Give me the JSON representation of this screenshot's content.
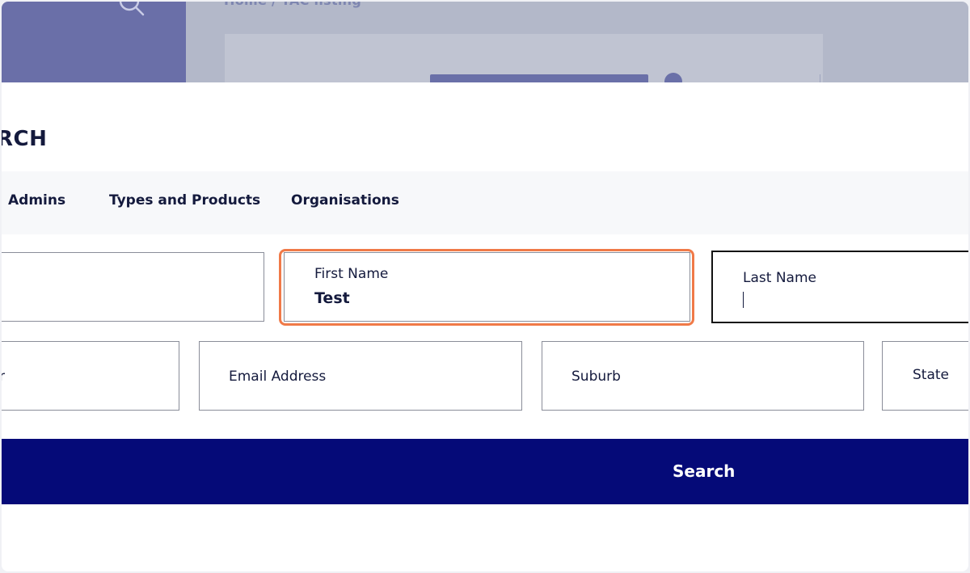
{
  "background": {
    "breadcrumb": "Home / TAC listing"
  },
  "panel": {
    "title": "RCH"
  },
  "tabs": [
    {
      "label": "Admins"
    },
    {
      "label": "Types and Products"
    },
    {
      "label": "Organisations"
    }
  ],
  "fields": {
    "first_name": {
      "label": "First Name",
      "value": "Test"
    },
    "last_name": {
      "label": "Last Name",
      "value": ""
    },
    "phone_partial": {
      "label": "r"
    },
    "email": {
      "label": "Email Address"
    },
    "suburb": {
      "label": "Suburb"
    },
    "state": {
      "label": "State"
    }
  },
  "search_button": {
    "label": "Search"
  },
  "colors": {
    "primary": "#050a78",
    "highlight": "#f07a48",
    "text": "#141a3d"
  }
}
